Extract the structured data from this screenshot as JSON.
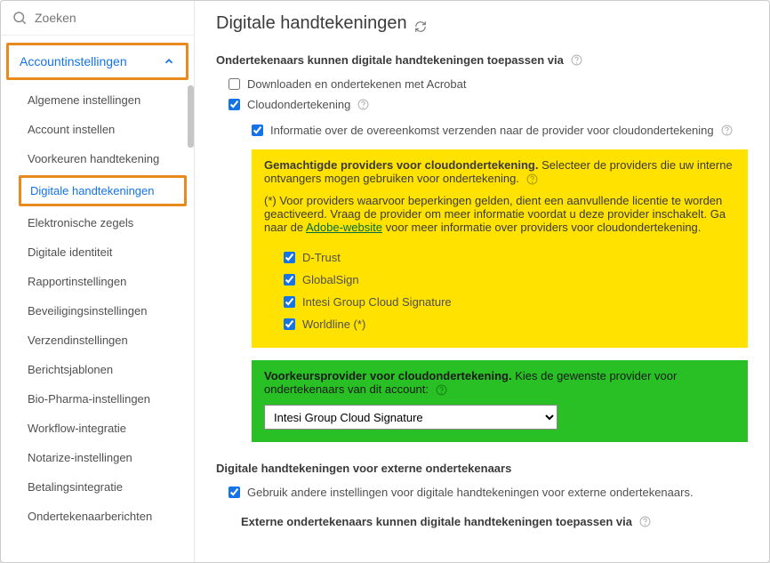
{
  "search": {
    "placeholder": "Zoeken"
  },
  "section_header": "Accountinstellingen",
  "nav": {
    "items": [
      "Algemene instellingen",
      "Account instellen",
      "Voorkeuren handtekening",
      "Digitale handtekeningen",
      "Elektronische zegels",
      "Digitale identiteit",
      "Rapportinstellingen",
      "Beveiligingsinstellingen",
      "Verzendinstellingen",
      "Berichtsjablonen",
      "Bio-Pharma-instellingen",
      "Workflow-integratie",
      "Notarize-instellingen",
      "Betalingsintegratie",
      "Ondertekenaarberichten"
    ],
    "active_index": 3
  },
  "page_title": "Digitale handtekeningen",
  "signers_section": {
    "heading": "Ondertekenaars kunnen digitale handtekeningen toepassen via",
    "download_label": "Downloaden en ondertekenen met Acrobat",
    "download_checked": false,
    "cloud_label": "Cloudondertekening",
    "cloud_checked": true,
    "cloud_info_label": "Informatie over de overeenkomst verzenden naar de provider voor cloudondertekening",
    "cloud_info_checked": true
  },
  "providers_block": {
    "title_bold": "Gemachtigde providers voor cloudondertekening.",
    "title_rest": "  Selecteer de providers die uw interne ontvangers mogen gebruiken voor ondertekening.",
    "note_prefix": "(*) Voor providers waarvoor beperkingen gelden, dient een aanvullende licentie te worden geactiveerd. Vraag de provider om meer informatie voordat u deze provider inschakelt. Ga naar de ",
    "note_link": "Adobe-website",
    "note_suffix": " voor meer informatie over providers voor cloudondertekening.",
    "items": [
      {
        "label": "D-Trust",
        "checked": true
      },
      {
        "label": "GlobalSign",
        "checked": true
      },
      {
        "label": "Intesi Group Cloud Signature",
        "checked": true
      },
      {
        "label": "Worldline (*)",
        "checked": true
      }
    ]
  },
  "pref_block": {
    "title_bold": "Voorkeursprovider voor cloudondertekening.",
    "title_rest": "  Kies de gewenste provider voor ondertekenaars van dit account:",
    "selected": "Intesi Group Cloud Signature"
  },
  "external_section": {
    "heading": "Digitale handtekeningen voor externe ondertekenaars",
    "use_other_label": "Gebruik andere instellingen voor digitale handtekeningen voor externe ondertekenaars.",
    "use_other_checked": true,
    "sub_heading": "Externe ondertekenaars kunnen digitale handtekeningen toepassen via"
  }
}
